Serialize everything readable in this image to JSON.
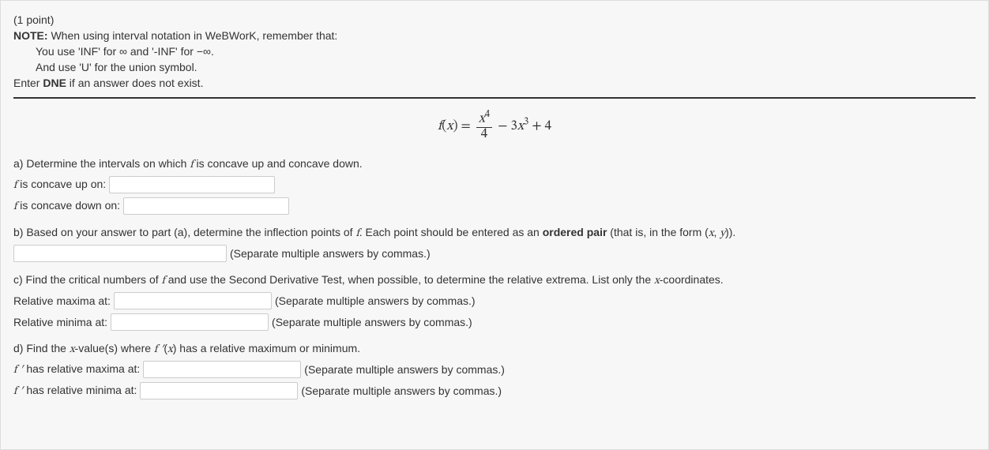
{
  "points": "(1 point)",
  "note": {
    "label": "NOTE:",
    "line0rest": " When using interval notation in WeBWorK, remember that:",
    "line1a": "You use 'INF' for ",
    "inf": "∞",
    "line1b": " and '-INF' for ",
    "ninf": "−∞",
    "line1c": ".",
    "line2": "And use 'U' for the union symbol.",
    "line3a": "Enter ",
    "dne": "DNE",
    "line3b": " if an answer does not exist."
  },
  "formula": {
    "lhs_f": "f",
    "lhs_open": "(",
    "lhs_x": "x",
    "lhs_close": ") = ",
    "num_x": "x",
    "num_pow": "4",
    "den": "4",
    "minus": " − 3",
    "x2": "x",
    "pow2": "3",
    "tail": " + 4"
  },
  "a": {
    "q": "a) Determine the intervals on which ",
    "f": "f",
    "qrest": " is concave up and concave down.",
    "up_pre": " is concave up on: ",
    "down_pre": " is concave down on: "
  },
  "b": {
    "q1": "b) Based on your answer to part (a), determine the inflection points of ",
    "f": "f",
    "q2": ". Each point should be entered as an ",
    "bold": "ordered pair",
    "q3": " (that is, in the form ",
    "pair_open": "(",
    "pair_x": "x",
    "pair_comma": ", ",
    "pair_y": "y",
    "pair_close": ")",
    "q4": ").",
    "hint": "(Separate multiple answers by commas.)"
  },
  "c": {
    "q1": "c) Find the critical numbers of ",
    "f": "f",
    "q2": " and use the Second Derivative Test, when possible, to determine the relative extrema. List only the ",
    "x": "x",
    "q3": "-coordinates.",
    "max_label": "Relative maxima at: ",
    "min_label": "Relative minima at: ",
    "hint": "(Separate multiple answers by commas.)"
  },
  "d": {
    "q1": "d) Find the ",
    "x": "x",
    "q2": "-value(s) where ",
    "fprime": "f ′",
    "q2b_open": "(",
    "q2b_x": "x",
    "q2b_close": ")",
    "q3": " has a relative maximum or minimum.",
    "max_pre": " has relative maxima at: ",
    "min_pre": " has relative minima at: ",
    "hint": "(Separate multiple answers by commas.)"
  }
}
